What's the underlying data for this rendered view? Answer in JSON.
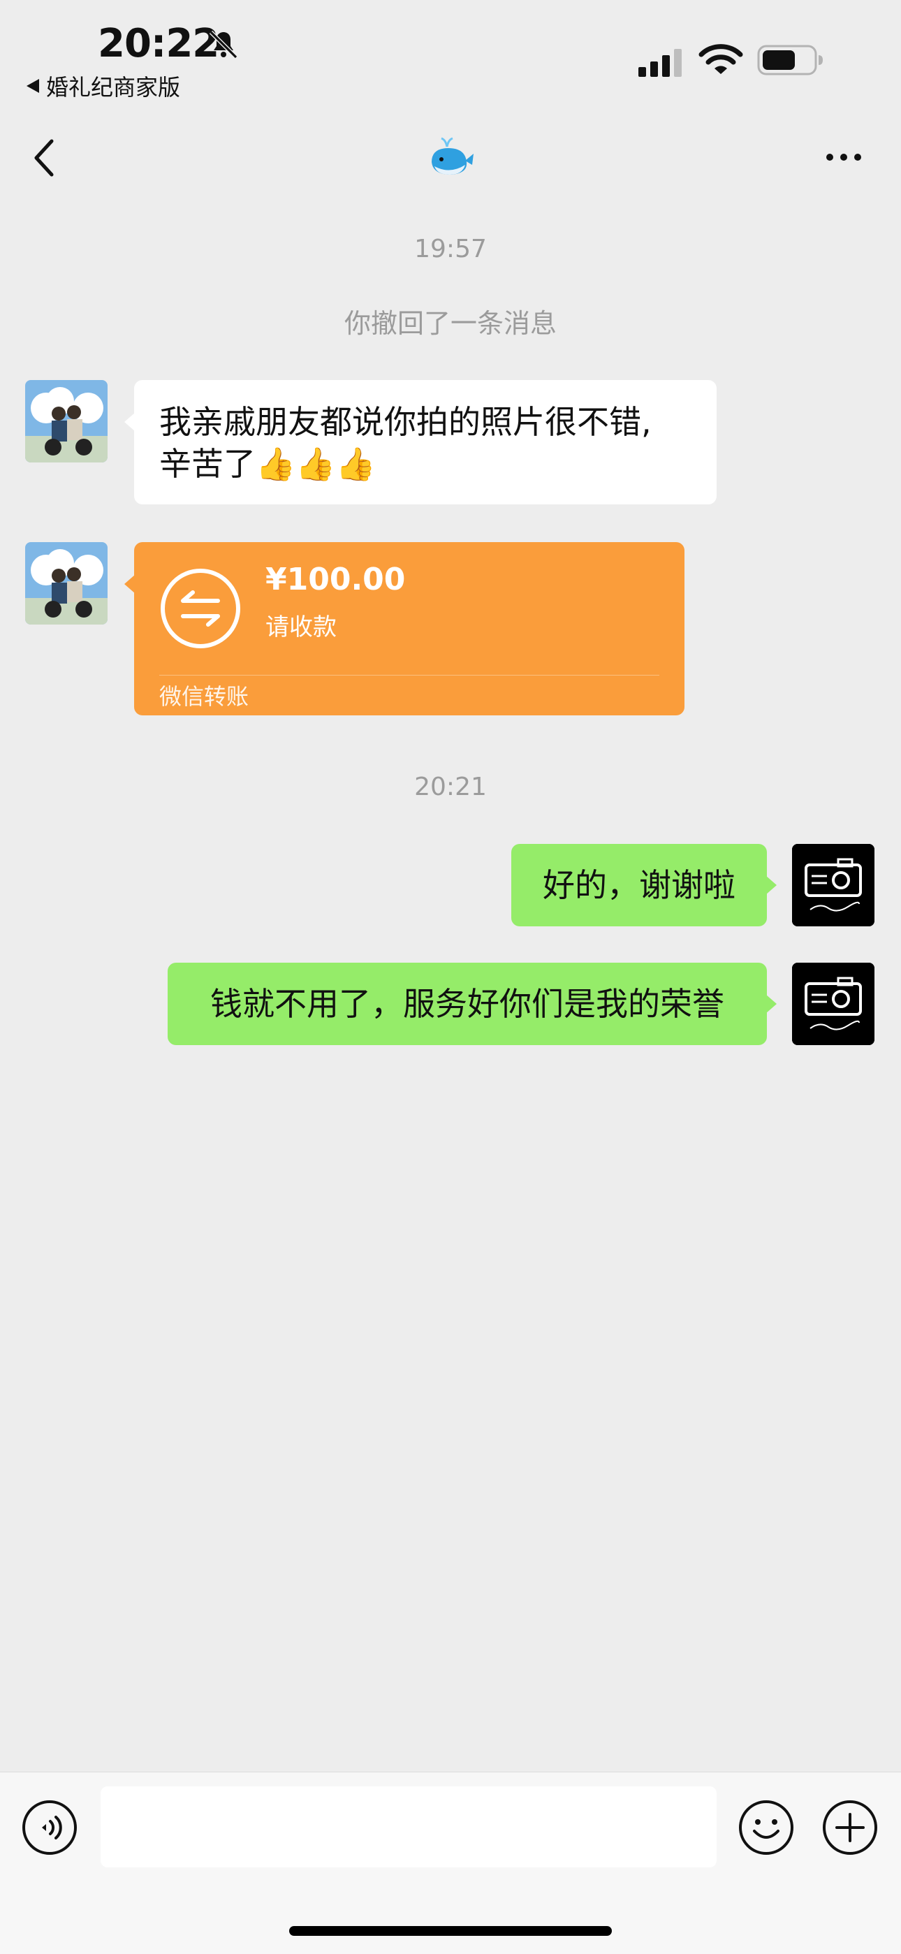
{
  "status_bar": {
    "time": "20:22",
    "back_app_label": "婚礼纪商家版",
    "icons": [
      "bell-muted-icon",
      "signal-icon",
      "wifi-icon",
      "battery-icon"
    ]
  },
  "nav": {
    "back_icon": "chevron-left-icon",
    "title_icon": "whale-emoji",
    "more_icon": "more-dots-icon"
  },
  "chat": {
    "time_1": "19:57",
    "recall_note": "你撤回了一条消息",
    "received_1_line1": "我亲戚朋友都说你拍的照片很不错,",
    "received_1_line2": "辛苦了",
    "thumbs": "👍👍👍",
    "transfer": {
      "amount": "¥100.00",
      "status": "请收款",
      "footer": "微信转账"
    },
    "time_2": "20:21",
    "sent_1": "好的，谢谢啦",
    "sent_2": "钱就不用了，服务好你们是我的荣誉"
  },
  "input": {
    "placeholder": "",
    "voice_icon": "voice-icon",
    "emoji_icon": "emoji-icon",
    "plus_icon": "plus-icon"
  },
  "colors": {
    "background": "#ededed",
    "sent_bubble": "#95ec69",
    "received_bubble": "#ffffff",
    "transfer_card": "#fa9d3b",
    "meta_text": "#9b9b9b"
  }
}
